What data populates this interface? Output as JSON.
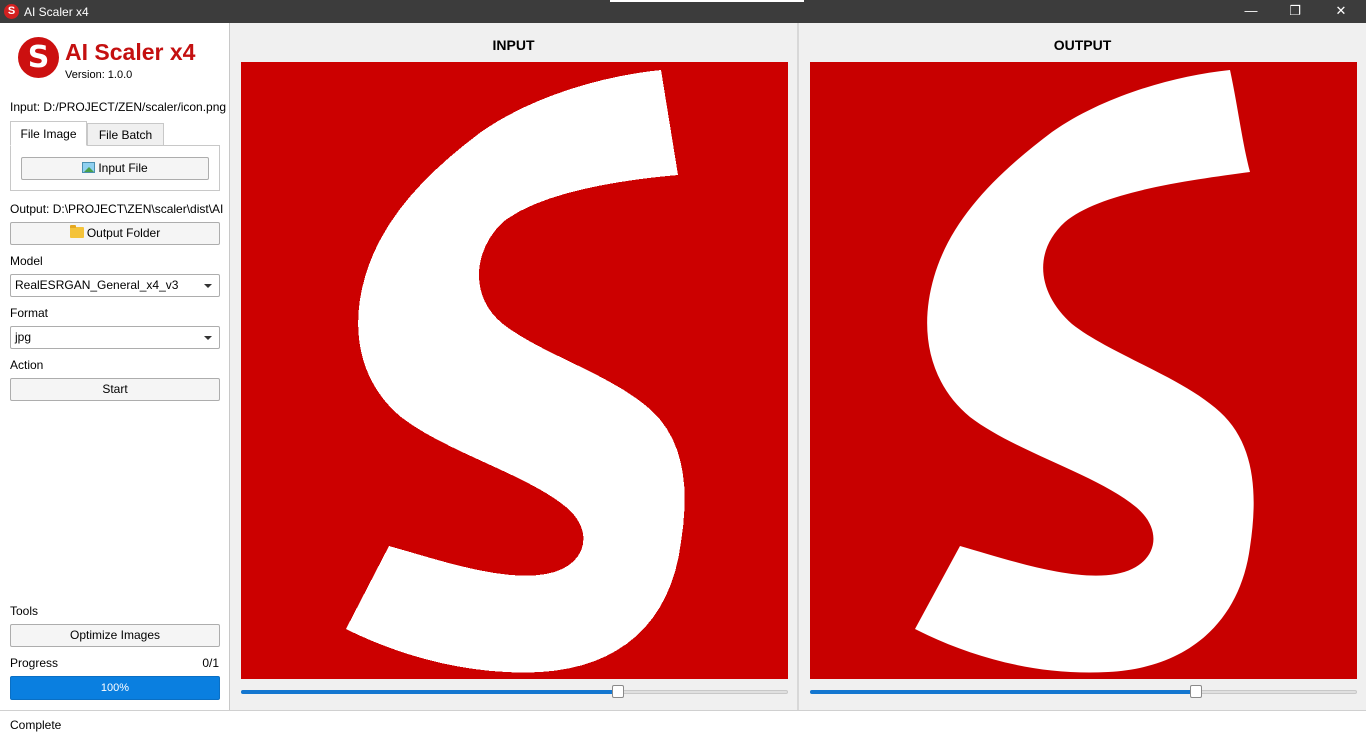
{
  "window": {
    "icon_letter": "S",
    "title": "AI Scaler x4",
    "minimize": "—",
    "restore": "❐",
    "close": "✕"
  },
  "sidebar": {
    "logo_letter": "S",
    "app_name": "AI Scaler x4",
    "version": "Version: 1.0.0",
    "input_path": "Input: D:/PROJECT/ZEN/scaler/icon.png",
    "tabs": [
      {
        "label": "File Image",
        "active": true
      },
      {
        "label": "File Batch",
        "active": false
      }
    ],
    "input_file_button": "Input File",
    "output_path": "Output: D:\\PROJECT\\ZEN\\scaler\\dist\\AI",
    "output_folder_button": "Output Folder",
    "model_label": "Model",
    "model_value": "RealESRGAN_General_x4_v3",
    "format_label": "Format",
    "format_value": "jpg",
    "action_label": "Action",
    "start_button": "Start",
    "tools_label": "Tools",
    "optimize_button": "Optimize Images",
    "progress_label": "Progress",
    "progress_count": "0/1",
    "progress_text": "100%",
    "progress_value": 1.0
  },
  "panes": {
    "input": {
      "title": "INPUT",
      "slider_value": 0.69
    },
    "output": {
      "title": "OUTPUT",
      "slider_value": 0.705
    }
  },
  "colors": {
    "brand_red": "#cc0000",
    "accent_blue": "#0a7fe0"
  },
  "status": {
    "text": "Complete"
  }
}
